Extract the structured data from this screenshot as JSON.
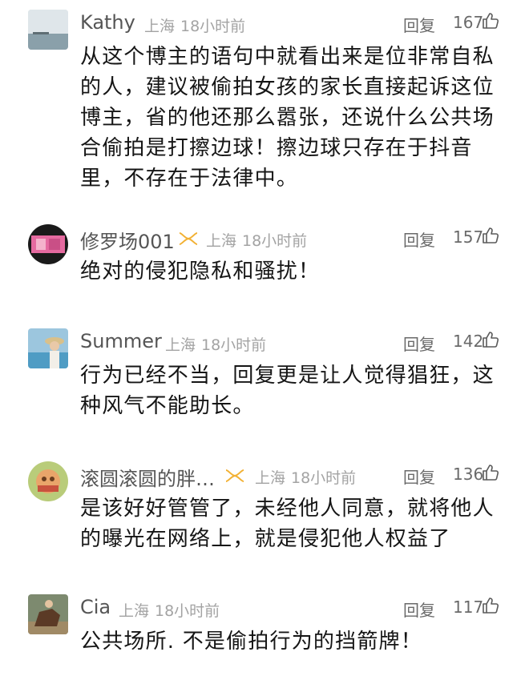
{
  "comments": [
    {
      "user": "Kathy",
      "badge": false,
      "location": "上海",
      "time": "18小时前",
      "reply_label": "回复",
      "likes": "167",
      "avatar": "sea-landscape-avatar",
      "text": "从这个博主的语句中就看出来是位非常自私的人，建议被偷拍女孩的家长直接起诉这位博主，省的他还那么嚣张，还说什么公共场合偷拍是打擦边球！擦边球只存在于抖音里，不存在于法律中。"
    },
    {
      "user": "修罗场001",
      "badge": true,
      "location": "上海",
      "time": "18小时前",
      "reply_label": "回复",
      "likes": "157",
      "avatar": "pink-screen-avatar",
      "text": "绝对的侵犯隐私和骚扰！"
    },
    {
      "user": "Summer",
      "badge": false,
      "location": "上海",
      "time": "18小时前",
      "reply_label": "回复",
      "likes": "142",
      "avatar": "beach-hat-avatar",
      "text": "行为已经不当，回复更是让人觉得猖狂，这种风气不能助长。"
    },
    {
      "user": "滚圆滚圆的胖…",
      "badge": true,
      "location": "上海",
      "time": "18小时前",
      "reply_label": "回复",
      "likes": "136",
      "avatar": "cartoon-avatar",
      "text": "是该好好管管了，未经他人同意，就将他人的曝光在网络上，就是侵犯他人权益了"
    },
    {
      "user": "Cia",
      "badge": false,
      "location": "上海",
      "time": "18小时前",
      "reply_label": "回复",
      "likes": "117",
      "avatar": "horse-rider-avatar",
      "text": "公共场所. 不是偷拍行为的挡箭牌！"
    }
  ],
  "colors": {
    "name": "#555555",
    "meta": "#a3a3a3",
    "text": "#151515",
    "badge": "#f2b134"
  },
  "icons": {
    "like": "thumbs-up-icon",
    "badge": "vip-badge-icon"
  }
}
